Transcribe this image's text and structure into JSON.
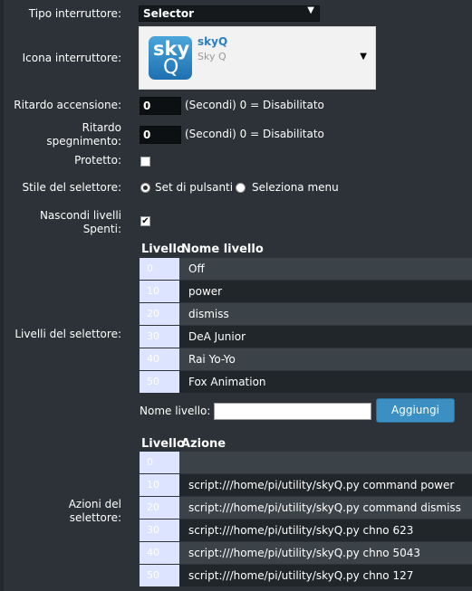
{
  "form": {
    "tipo_label": "Tipo interruttore:",
    "tipo_value": "Selector",
    "icona_label": "Icona interruttore:",
    "icona_name": "skyQ",
    "icona_sub": "Sky Q",
    "icona_tile_line1": "sky",
    "icona_tile_line2": "Q",
    "ritardo_acc_label": "Ritardo accensione:",
    "ritardo_acc_value": "0",
    "ritardo_acc_hint": "(Secondi) 0 = Disabilitato",
    "ritardo_spe_label_1": "Ritardo",
    "ritardo_spe_label_2": "spegnimento:",
    "ritardo_spe_value": "0",
    "ritardo_spe_hint": "(Secondi) 0 = Disabilitato",
    "protetto_label": "Protetto:",
    "protetto_checked": false,
    "stile_label": "Stile del selettore:",
    "stile_options": [
      "Set di pulsanti",
      "Seleziona menu"
    ],
    "stile_selected": "Set di pulsanti",
    "nascondi_label_1": "Nascondi livelli",
    "nascondi_label_2": "Spenti:",
    "nascondi_checked": true
  },
  "levels": {
    "section_label": "Livelli del selettore:",
    "col_level": "Livello",
    "col_name": "Nome livello",
    "rows": [
      {
        "level": "0",
        "name": "Off"
      },
      {
        "level": "10",
        "name": "power"
      },
      {
        "level": "20",
        "name": "dismiss"
      },
      {
        "level": "30",
        "name": "DeA Junior"
      },
      {
        "level": "40",
        "name": "Rai Yo-Yo"
      },
      {
        "level": "50",
        "name": "Fox Animation"
      }
    ],
    "name_label": "Nome livello:",
    "name_value": "",
    "add_button": "Aggiungi"
  },
  "actions": {
    "section_label_1": "Azioni del",
    "section_label_2": "selettore:",
    "col_level": "Livello",
    "col_action": "Azione",
    "rows": [
      {
        "level": "0",
        "action": ""
      },
      {
        "level": "10",
        "action": "script:///home/pi/utility/skyQ.py command power"
      },
      {
        "level": "20",
        "action": "script:///home/pi/utility/skyQ.py command dismiss"
      },
      {
        "level": "30",
        "action": "script:///home/pi/utility/skyQ.py chno 623"
      },
      {
        "level": "40",
        "action": "script:///home/pi/utility/skyQ.py chno 5043"
      },
      {
        "level": "50",
        "action": "script:///home/pi/utility/skyQ.py chno 127"
      }
    ]
  },
  "colors": {
    "background": "#2c3237",
    "row_light": "#3b4248",
    "row_dark": "#21262a",
    "level_cell": "#dde4ff",
    "accent": "#3b8fc3",
    "sky_blue": "#2a7fc0"
  },
  "icons": [
    "dropdown-arrow-icon",
    "skyq-app-icon",
    "checkbox-icon",
    "radio-icon"
  ]
}
